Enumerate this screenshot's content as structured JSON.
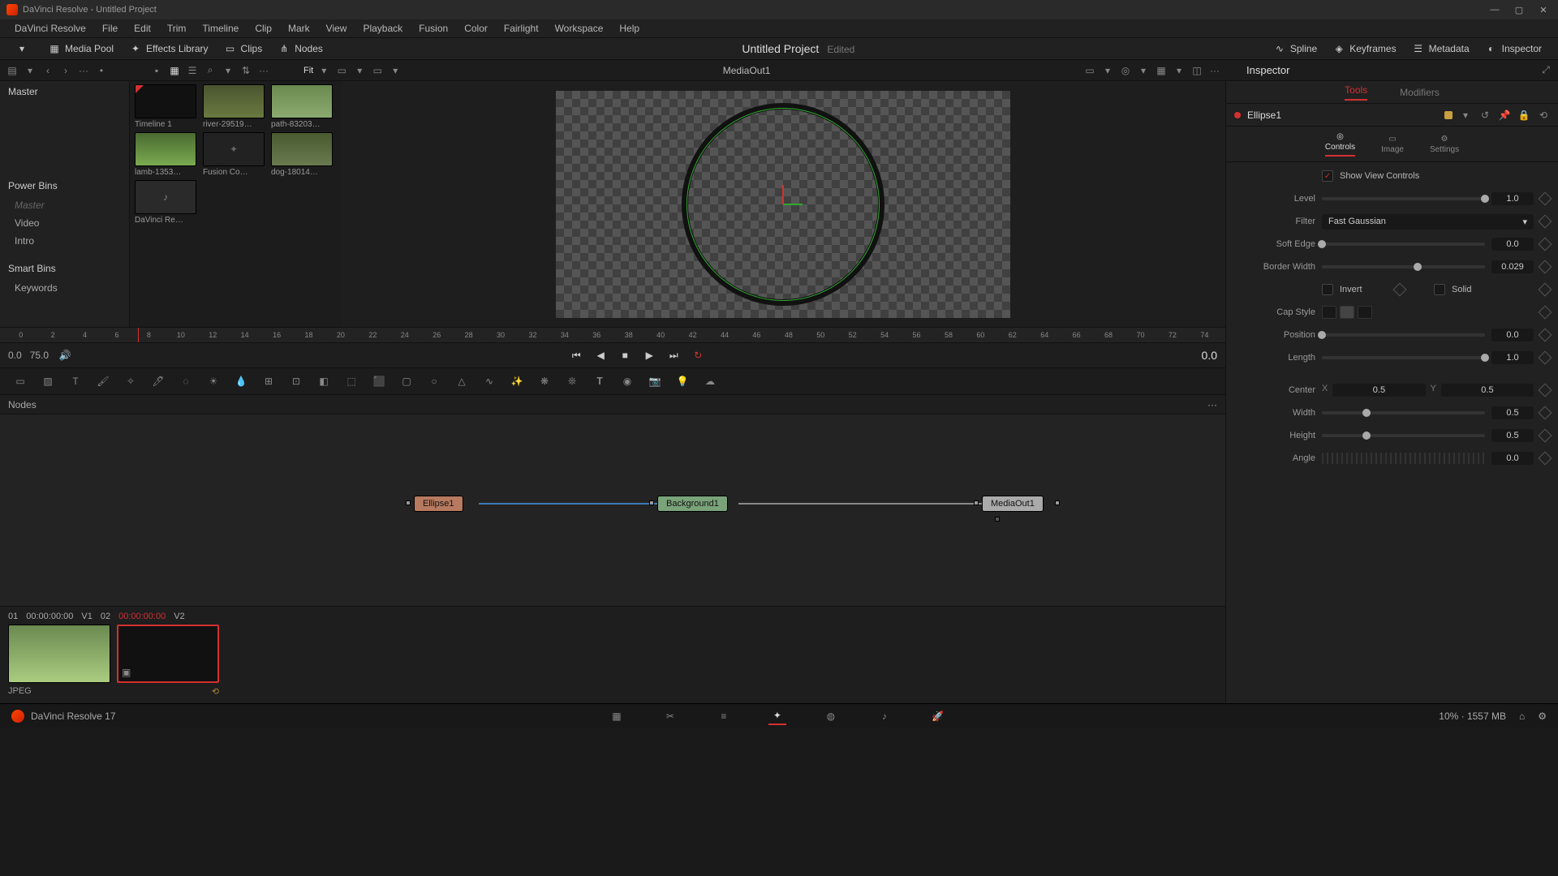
{
  "window": {
    "title": "DaVinci Resolve - Untitled Project"
  },
  "menu": [
    "DaVinci Resolve",
    "File",
    "Edit",
    "Trim",
    "Timeline",
    "Clip",
    "Mark",
    "View",
    "Playback",
    "Fusion",
    "Color",
    "Fairlight",
    "Workspace",
    "Help"
  ],
  "shelf": {
    "left": [
      {
        "name": "media-pool-toggle",
        "label": "Media Pool"
      },
      {
        "name": "effects-library-toggle",
        "label": "Effects Library"
      },
      {
        "name": "clips-toggle",
        "label": "Clips"
      },
      {
        "name": "nodes-toggle",
        "label": "Nodes"
      }
    ],
    "project_title": "Untitled Project",
    "edited": "Edited",
    "right": [
      {
        "name": "spline-toggle",
        "label": "Spline"
      },
      {
        "name": "keyframes-toggle",
        "label": "Keyframes"
      },
      {
        "name": "metadata-toggle",
        "label": "Metadata"
      },
      {
        "name": "inspector-toggle",
        "label": "Inspector"
      }
    ]
  },
  "toolbar": {
    "fit": "Fit",
    "viewer_title": "MediaOut1",
    "inspector_title": "Inspector"
  },
  "bins": {
    "master": "Master",
    "power_bins": "Power Bins",
    "power_items": [
      "Master",
      "Video",
      "Intro"
    ],
    "smart_bins": "Smart Bins",
    "smart_items": [
      "Keywords"
    ]
  },
  "clips": [
    {
      "name": "Timeline 1",
      "kind": "timeline"
    },
    {
      "name": "river-29519…",
      "kind": "video"
    },
    {
      "name": "path-83203…",
      "kind": "video"
    },
    {
      "name": "lamb-1353…",
      "kind": "video"
    },
    {
      "name": "Fusion Co…",
      "kind": "comp"
    },
    {
      "name": "dog-18014…",
      "kind": "video"
    },
    {
      "name": "DaVinci Re…",
      "kind": "audio"
    }
  ],
  "ruler_ticks": [
    "0",
    "2",
    "4",
    "6",
    "8",
    "10",
    "12",
    "14",
    "16",
    "18",
    "20",
    "22",
    "24",
    "26",
    "28",
    "30",
    "32",
    "34",
    "36",
    "38",
    "40",
    "42",
    "44",
    "46",
    "48",
    "50",
    "52",
    "54",
    "56",
    "58",
    "60",
    "62",
    "64",
    "66",
    "68",
    "70",
    "72",
    "74"
  ],
  "transport": {
    "start": "0.0",
    "end": "75.0",
    "current": "0.0"
  },
  "nodes": {
    "panel_title": "Nodes",
    "ellipse": "Ellipse1",
    "background": "Background1",
    "mediaout": "MediaOut1"
  },
  "inspector": {
    "tabs": [
      "Tools",
      "Modifiers"
    ],
    "node_name": "Ellipse1",
    "subtabs": [
      "Controls",
      "Image",
      "Settings"
    ],
    "show_view_controls": "Show View Controls",
    "params": {
      "level": {
        "label": "Level",
        "value": "1.0"
      },
      "filter": {
        "label": "Filter",
        "value": "Fast Gaussian"
      },
      "soft_edge": {
        "label": "Soft Edge",
        "value": "0.0"
      },
      "border_width": {
        "label": "Border Width",
        "value": "0.029"
      },
      "invert": {
        "label": "Invert"
      },
      "solid": {
        "label": "Solid"
      },
      "cap_style": {
        "label": "Cap Style"
      },
      "position": {
        "label": "Position",
        "value": "0.0"
      },
      "length": {
        "label": "Length",
        "value": "1.0"
      },
      "center": {
        "label": "Center",
        "x_label": "X",
        "x": "0.5",
        "y_label": "Y",
        "y": "0.5"
      },
      "width": {
        "label": "Width",
        "value": "0.5"
      },
      "height": {
        "label": "Height",
        "value": "0.5"
      },
      "angle": {
        "label": "Angle",
        "value": "0.0"
      }
    }
  },
  "tray": {
    "head": {
      "clip1_idx": "01",
      "clip1_tc": "00:00:00:00",
      "v1": "V1",
      "clip2_idx": "02",
      "clip2_tc": "00:00:00:00",
      "v2": "V2"
    },
    "meta": "JPEG"
  },
  "bottom": {
    "app": "DaVinci Resolve 17",
    "status": "10%  ·  1557 MB"
  }
}
